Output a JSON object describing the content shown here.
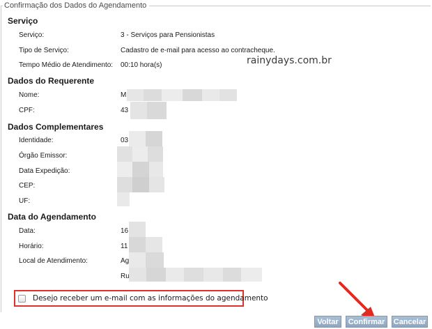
{
  "legend": "Confirmação dos Dados do Agendamento",
  "watermark": "rainydays.com.br",
  "sections": {
    "servico": {
      "title": "Serviço",
      "rows": [
        {
          "label": "Serviço:",
          "value": "3 - Serviços para Pensionistas"
        },
        {
          "label": "Tipo de Serviço:",
          "value": "Cadastro de e-mail para acesso ao contracheque."
        },
        {
          "label": "Tempo Médio de Atendimento:",
          "value": "00:10 hora(s)"
        }
      ]
    },
    "requerente": {
      "title": "Dados do Requerente",
      "rows": [
        {
          "label": "Nome:",
          "value": "M"
        },
        {
          "label": "CPF:",
          "value": "43"
        }
      ]
    },
    "complementares": {
      "title": "Dados Complementares",
      "rows": [
        {
          "label": "Identidade:",
          "value": "03"
        },
        {
          "label": "Órgão Emissor:",
          "value": ""
        },
        {
          "label": "Data Expedição:",
          "value": ""
        },
        {
          "label": "CEP:",
          "value": ""
        },
        {
          "label": "UF:",
          "value": ""
        }
      ]
    },
    "agendamento": {
      "title": "Data do Agendamento",
      "rows": [
        {
          "label": "Data:",
          "value": "16"
        },
        {
          "label": "Horário:",
          "value": "11"
        },
        {
          "label": "Local de Atendimento:",
          "value": "Ag"
        },
        {
          "label": "",
          "value": "Ru"
        }
      ]
    }
  },
  "email_option": {
    "label": "Desejo receber um e-mail com as informações do agendamento",
    "checked": false
  },
  "buttons": {
    "voltar": "Voltar",
    "confirmar": "Confirmar",
    "cancelar": "Cancelar"
  },
  "colors": {
    "highlight_border": "#e0302a",
    "button_bg": "#9cb3cc",
    "arrow": "#e02b23"
  },
  "icons": {
    "annotation_arrow": "arrow-icon"
  }
}
